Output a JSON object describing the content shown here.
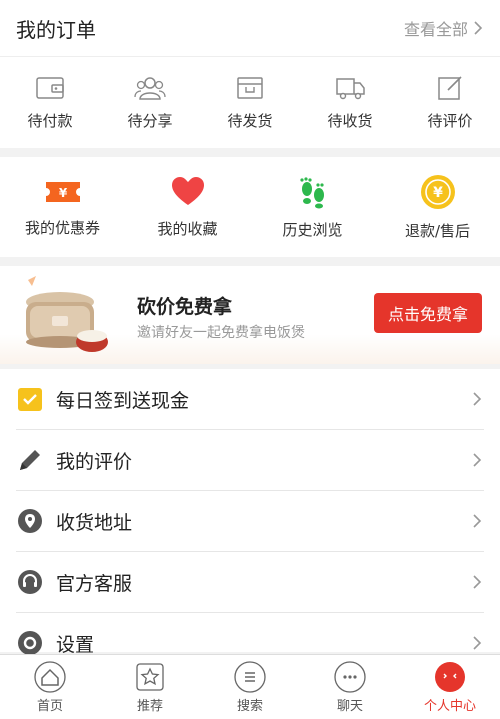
{
  "orders": {
    "title": "我的订单",
    "view_all": "查看全部",
    "items": [
      {
        "label": "待付款",
        "icon": "wallet-icon"
      },
      {
        "label": "待分享",
        "icon": "group-icon"
      },
      {
        "label": "待发货",
        "icon": "box-icon"
      },
      {
        "label": "待收货",
        "icon": "truck-icon"
      },
      {
        "label": "待评价",
        "icon": "edit-icon"
      }
    ]
  },
  "quick": {
    "items": [
      {
        "label": "我的优惠券",
        "icon": "coupon-icon",
        "color": "#f4651f"
      },
      {
        "label": "我的收藏",
        "icon": "heart-icon",
        "color": "#ef4444"
      },
      {
        "label": "历史浏览",
        "icon": "footprint-icon",
        "color": "#2db84d"
      },
      {
        "label": "退款/售后",
        "icon": "yen-coin-icon",
        "color": "#f6c21c"
      }
    ]
  },
  "promo": {
    "title": "砍价免费拿",
    "subtitle": "邀请好友一起免费拿电饭煲",
    "button": "点击免费拿"
  },
  "menu": {
    "items": [
      {
        "label": "每日签到送现金",
        "icon": "checkin-icon"
      },
      {
        "label": "我的评价",
        "icon": "pencil-icon"
      },
      {
        "label": "收货地址",
        "icon": "location-icon"
      },
      {
        "label": "官方客服",
        "icon": "headset-icon"
      },
      {
        "label": "设置",
        "icon": "gear-icon"
      }
    ]
  },
  "nav": {
    "items": [
      {
        "label": "首页",
        "icon": "home-icon"
      },
      {
        "label": "推荐",
        "icon": "recommend-icon"
      },
      {
        "label": "搜索",
        "icon": "search-icon"
      },
      {
        "label": "聊天",
        "icon": "chat-icon"
      },
      {
        "label": "个人中心",
        "icon": "profile-icon"
      }
    ],
    "active_color": "#e5352b"
  }
}
